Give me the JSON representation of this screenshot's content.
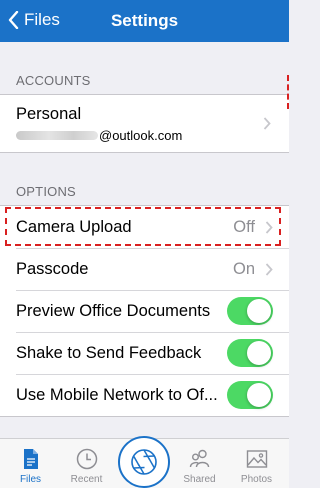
{
  "nav": {
    "back_label": "Files",
    "title": "Settings"
  },
  "accounts": {
    "header": "ACCOUNTS",
    "personal": {
      "label": "Personal",
      "email_suffix": "@outlook.com"
    }
  },
  "options": {
    "header": "OPTIONS",
    "rows": [
      {
        "label": "Camera Upload",
        "value": "Off",
        "type": "disclosure"
      },
      {
        "label": "Passcode",
        "value": "On",
        "type": "disclosure"
      },
      {
        "label": "Preview Office Documents",
        "type": "toggle",
        "on": true
      },
      {
        "label": "Shake to Send Feedback",
        "type": "toggle",
        "on": true
      },
      {
        "label": "Use Mobile Network to Of...",
        "type": "toggle",
        "on": true
      }
    ]
  },
  "tabs": [
    {
      "label": "Files",
      "icon": "files-icon",
      "active": true
    },
    {
      "label": "Recent",
      "icon": "clock-icon"
    },
    {
      "label": "Shared",
      "icon": "people-icon"
    },
    {
      "label": "Photos",
      "icon": "photos-icon"
    }
  ],
  "colors": {
    "brand": "#1b72c8",
    "toggle_on": "#4cd964",
    "highlight": "#d92020"
  }
}
